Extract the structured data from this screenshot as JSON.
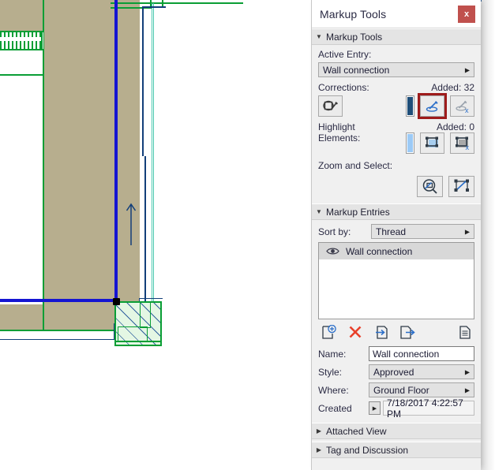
{
  "window": {
    "title": "Markup Tools",
    "close_label": "x",
    "close_icon": "close-icon"
  },
  "markup_tools": {
    "header": "Markup Tools",
    "collapse_icon": "triangle-down-icon",
    "active_entry_label": "Active Entry:",
    "active_entry_value": "Wall connection",
    "corrections_label": "Corrections:",
    "corrections_added": "Added: 32",
    "highlight_label_line1": "Highlight",
    "highlight_label_line2": "Elements:",
    "highlight_added": "Added: 0",
    "zoom_select_label": "Zoom and Select:",
    "buttons": {
      "paint_correction": "paint-correction-icon",
      "add_correction": "add-correction-icon",
      "remove_correction": "remove-correction-icon",
      "add_highlight": "add-highlight-icon",
      "remove_highlight": "remove-highlight-icon",
      "zoom_to_entry": "zoom-to-entry-icon",
      "select_elements": "select-elements-icon",
      "correction_color_strip": "correction-color-strip",
      "highlight_color_strip": "highlight-color-strip"
    }
  },
  "markup_entries": {
    "header": "Markup Entries",
    "collapse_icon": "triangle-down-icon",
    "sort_by_label": "Sort by:",
    "sort_by_value": "Thread",
    "entries": [
      {
        "name": "Wall connection",
        "visibility_icon": "eye-icon"
      }
    ],
    "toolbar": {
      "new_entry": "new-entry-icon",
      "delete_entry": "delete-entry-icon",
      "import_entry": "import-entry-icon",
      "export_entry": "export-entry-icon",
      "entry_details": "entry-details-icon"
    }
  },
  "entry_form": {
    "name_label": "Name:",
    "name_value": "Wall connection",
    "style_label": "Style:",
    "style_value": "Approved",
    "where_label": "Where:",
    "where_value": "Ground Floor",
    "created_label": "Created",
    "created_value": "7/18/2017 4:22:57 PM"
  },
  "collapsed_sections": [
    {
      "label": "Attached View",
      "icon": "triangle-right-icon"
    },
    {
      "label": "Tag and Discussion",
      "icon": "triangle-right-icon"
    }
  ],
  "colors": {
    "accent_blue": "#2a6099",
    "close_red": "#c0504d",
    "selection_red": "#9e1b1b",
    "wall_fill": "#b7ae8e",
    "element_green": "#0a9e35",
    "highlight_fill": "#e4f7e4",
    "marked_wall_blue": "#1414d2",
    "panel_bg": "#f0f0f0"
  },
  "drawing": {
    "description": "floor-plan-wall-connection-detail"
  }
}
